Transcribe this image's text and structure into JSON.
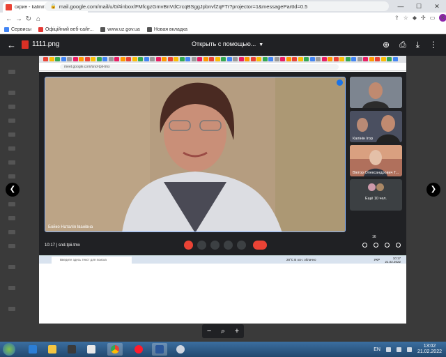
{
  "browser": {
    "tab_title": "скрин - kalininihor@gmail.com",
    "url": "mail.google.com/mail/u/0/#inbox/FMfcgzGmvBnVdCrcqBSggJpbnvfZqFTr?projector=1&messagePartId=0.5",
    "profile_initial": "K"
  },
  "bookmarks": [
    {
      "label": "Сервисы",
      "color": "#4285f4"
    },
    {
      "label": "Офіційний веб-сайт...",
      "color": "#e53935"
    },
    {
      "label": "www.uz.gov.ua",
      "color": "#555555"
    },
    {
      "label": "Новая вкладка",
      "color": "#555555"
    }
  ],
  "viewer": {
    "filename": "1111.png",
    "open_with": "Открыть с помощью..."
  },
  "image": {
    "inner_url": "meet.google.com/snd-tpii-tmx",
    "speaker_name": "Бойко Наталія Іванівна",
    "tiles": [
      {
        "name": ""
      },
      {
        "name": "Калінін Ігор"
      },
      {
        "name": "Віктор Олександрович Т..."
      }
    ],
    "more_label": "Ещё 10 чел.",
    "meet_time": "10:17",
    "meet_code": "snd-tpii-tmx",
    "participants_count": "16",
    "win_search": "Введите здесь текст для поиска",
    "weather": "28°C  В осн. облачно",
    "win_lang": "УКР",
    "win_time": "10:17",
    "win_date": "21.02.2022"
  },
  "zoom": {
    "minus": "−",
    "plus": "+"
  },
  "taskbar": {
    "lang": "EN",
    "time": "13:02",
    "date": "21.02.2022"
  }
}
